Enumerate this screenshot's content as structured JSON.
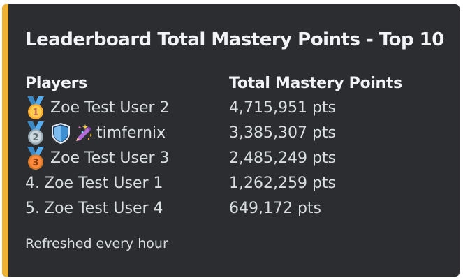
{
  "embed": {
    "accent_color": "#f0b232",
    "title": "Leaderboard Total Mastery Points - Top 10",
    "columns": {
      "players_header": "Players",
      "points_header": "Total Mastery Points"
    },
    "rows": [
      {
        "rank_icon": "gold-medal-icon",
        "rank_number": "1",
        "badges": [],
        "name": "Zoe Test User 2",
        "points": "4,715,951 pts"
      },
      {
        "rank_icon": "silver-medal-icon",
        "rank_number": "2",
        "badges": [
          "shield-icon",
          "sparkle-pen-icon"
        ],
        "name": "timfernix",
        "points": "3,385,307 pts"
      },
      {
        "rank_icon": "bronze-medal-icon",
        "rank_number": "3",
        "badges": [],
        "name": "Zoe Test User 3",
        "points": "2,485,249 pts"
      },
      {
        "rank_prefix": "4.",
        "name": "Zoe Test User 1",
        "points": "1,262,259 pts"
      },
      {
        "rank_prefix": "5.",
        "name": "Zoe Test User 4",
        "points": "649,172 pts"
      }
    ],
    "footer": "Refreshed every hour"
  }
}
